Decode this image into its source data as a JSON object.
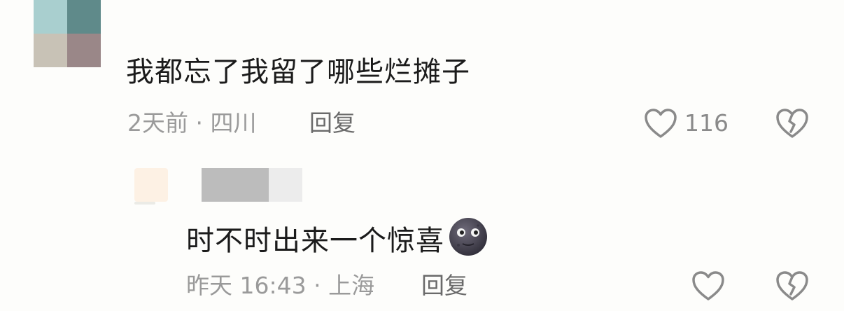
{
  "comment": {
    "text": "我都忘了我留了哪些烂摊子",
    "time": "2天前",
    "separator": "·",
    "location": "四川",
    "reply_label": "回复",
    "like_count": "116",
    "icons": {
      "like": "heart-outline-icon",
      "dislike": "broken-heart-icon"
    }
  },
  "reply": {
    "text": "时不时出来一个惊喜",
    "emoji": "new-moon-face-emoji",
    "time": "昨天 16:43",
    "separator": "·",
    "location": "上海",
    "reply_label": "回复",
    "icons": {
      "like": "heart-outline-icon",
      "dislike": "broken-heart-icon"
    }
  },
  "colors": {
    "primary_text": "#1b1b1b",
    "meta_text": "#9a9a9a",
    "reply_button": "#6a6a6a",
    "icon_stroke": "#8a8a8a"
  }
}
